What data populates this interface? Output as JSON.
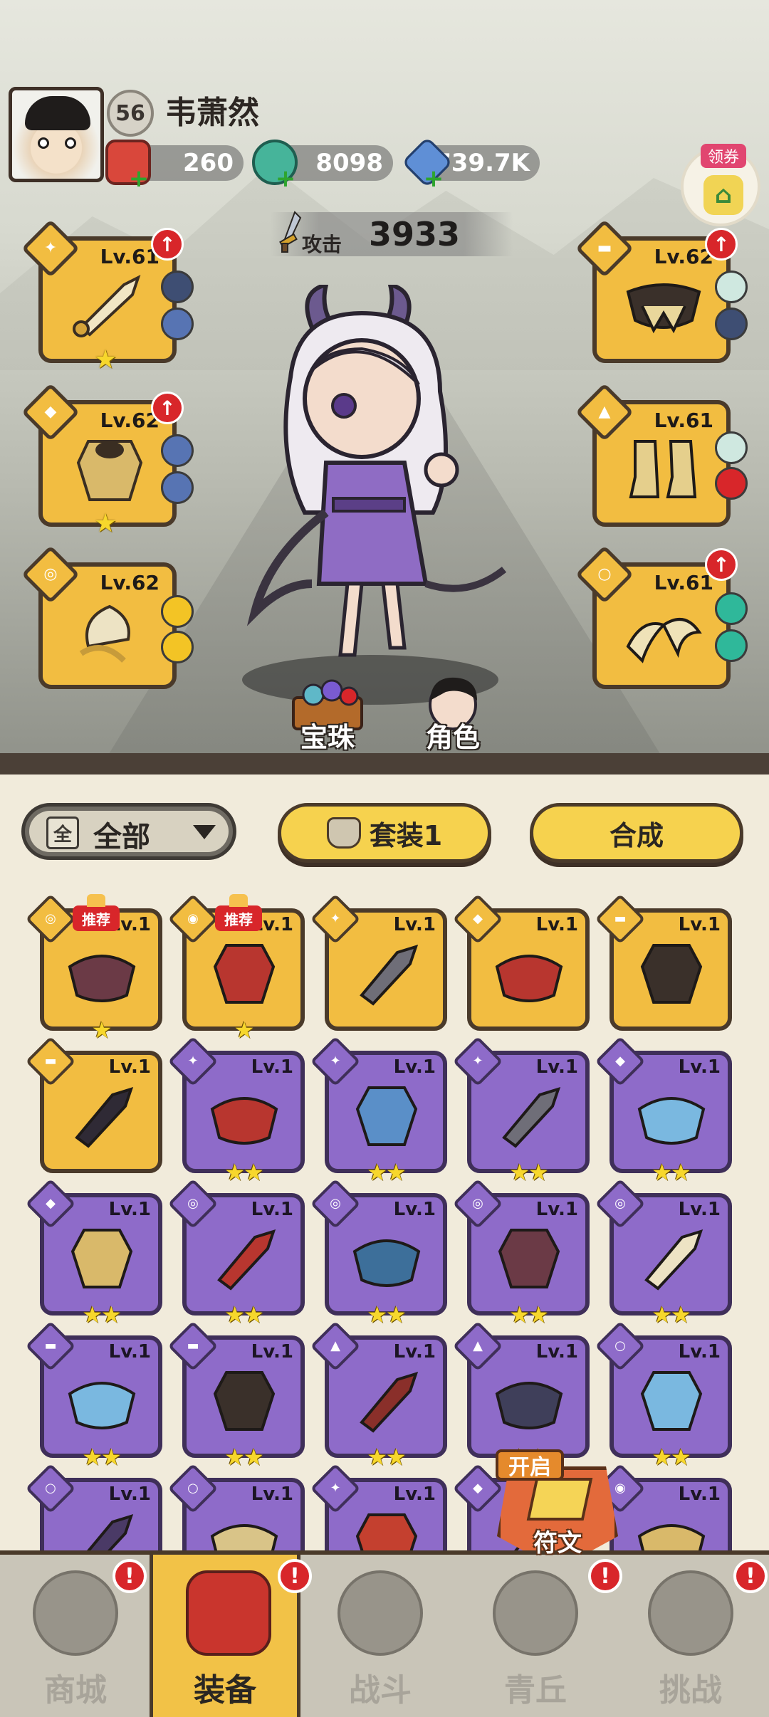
{
  "player": {
    "level": "56",
    "name": "韦萧然"
  },
  "currencies": [
    {
      "name": "red-envelope",
      "value": "260"
    },
    {
      "name": "jade-dragon",
      "value": "8098"
    },
    {
      "name": "crystal",
      "value": "739.7K"
    }
  ],
  "coupon": {
    "label": "领券"
  },
  "attack": {
    "label": "攻击",
    "value": "3933"
  },
  "equipped": {
    "left": [
      {
        "slot": "weapon",
        "level": "Lv.61",
        "stars": "★",
        "upgrade": true,
        "gems": [
          "#3e4e73",
          "#5774b3"
        ]
      },
      {
        "slot": "armor",
        "level": "Lv.62",
        "stars": "★",
        "upgrade": true,
        "gems": [
          "#5774b3",
          "#5774b3"
        ]
      },
      {
        "slot": "bracer",
        "level": "Lv.62",
        "stars": "",
        "upgrade": false,
        "gems": [
          "#f3c425",
          "#f3c425"
        ]
      }
    ],
    "right": [
      {
        "slot": "belt",
        "level": "Lv.62",
        "stars": "",
        "upgrade": true,
        "gems": [
          "#cfe8e0",
          "#3e4e73"
        ]
      },
      {
        "slot": "boots",
        "level": "Lv.61",
        "stars": "",
        "upgrade": false,
        "gems": [
          "#cfe8e0",
          "#d8262a"
        ]
      },
      {
        "slot": "ring",
        "level": "Lv.61",
        "stars": "",
        "upgrade": true,
        "gems": [
          "#2fb89a",
          "#2fb89a"
        ]
      }
    ]
  },
  "scene_buttons": {
    "gems": "宝珠",
    "character": "角色"
  },
  "toolbar": {
    "filter_icon": "全",
    "filter_label": "全部",
    "set_label": "套装1",
    "merge_label": "合成"
  },
  "rec_tag": "推荐",
  "items": [
    {
      "rarity": "gold",
      "level": "Lv.1",
      "stars": "★",
      "rec": true
    },
    {
      "rarity": "gold",
      "level": "Lv.1",
      "stars": "★",
      "rec": true
    },
    {
      "rarity": "gold",
      "level": "Lv.1",
      "stars": "",
      "rec": false
    },
    {
      "rarity": "gold",
      "level": "Lv.1",
      "stars": "",
      "rec": false
    },
    {
      "rarity": "gold",
      "level": "Lv.1",
      "stars": "",
      "rec": false
    },
    {
      "rarity": "gold",
      "level": "Lv.1",
      "stars": "",
      "rec": false
    },
    {
      "rarity": "purple",
      "level": "Lv.1",
      "stars": "★★",
      "rec": false
    },
    {
      "rarity": "purple",
      "level": "Lv.1",
      "stars": "★★",
      "rec": false
    },
    {
      "rarity": "purple",
      "level": "Lv.1",
      "stars": "★★",
      "rec": false
    },
    {
      "rarity": "purple",
      "level": "Lv.1",
      "stars": "★★",
      "rec": false
    },
    {
      "rarity": "purple",
      "level": "Lv.1",
      "stars": "★★",
      "rec": false
    },
    {
      "rarity": "purple",
      "level": "Lv.1",
      "stars": "★★",
      "rec": false
    },
    {
      "rarity": "purple",
      "level": "Lv.1",
      "stars": "★★",
      "rec": false
    },
    {
      "rarity": "purple",
      "level": "Lv.1",
      "stars": "★★",
      "rec": false
    },
    {
      "rarity": "purple",
      "level": "Lv.1",
      "stars": "★★",
      "rec": false
    },
    {
      "rarity": "purple",
      "level": "Lv.1",
      "stars": "★★",
      "rec": false
    },
    {
      "rarity": "purple",
      "level": "Lv.1",
      "stars": "★★",
      "rec": false
    },
    {
      "rarity": "purple",
      "level": "Lv.1",
      "stars": "★★",
      "rec": false
    },
    {
      "rarity": "purple",
      "level": "Lv.1",
      "stars": "★★",
      "rec": false
    },
    {
      "rarity": "purple",
      "level": "Lv.1",
      "stars": "★★",
      "rec": false
    },
    {
      "rarity": "purple",
      "level": "Lv.1",
      "stars": "",
      "rec": false
    },
    {
      "rarity": "purple",
      "level": "Lv.1",
      "stars": "",
      "rec": false
    },
    {
      "rarity": "purple",
      "level": "Lv.1",
      "stars": "",
      "rec": false
    },
    {
      "rarity": "purple",
      "level": "Lv.1",
      "stars": "",
      "rec": false
    },
    {
      "rarity": "purple",
      "level": "Lv.1",
      "stars": "",
      "rec": false
    }
  ],
  "rune_popup": {
    "open": "开启",
    "label": "符文"
  },
  "nav": [
    {
      "label": "商城",
      "active": false,
      "alert": true
    },
    {
      "label": "装备",
      "active": true,
      "alert": true
    },
    {
      "label": "战斗",
      "active": false,
      "alert": false
    },
    {
      "label": "青丘",
      "active": false,
      "alert": true
    },
    {
      "label": "挑战",
      "active": false,
      "alert": true
    }
  ],
  "alert_mark": "!",
  "up_mark": "↑",
  "plus_mark": "+"
}
